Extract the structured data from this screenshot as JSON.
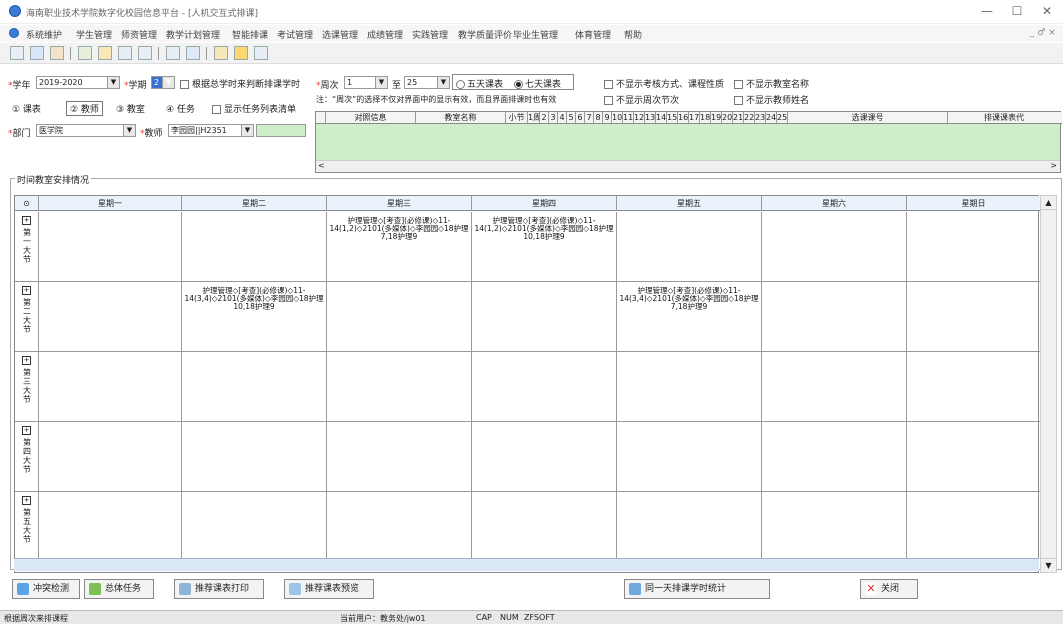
{
  "window": {
    "title": "海南职业技术学院数字化校园信息平台 - [人机交互式排课]",
    "min": "—",
    "max": "☐",
    "close": "✕"
  },
  "menu": [
    "系统维护",
    "学生管理",
    "师资管理",
    "教学计划管理",
    "智能排课",
    "考试管理",
    "选课管理",
    "成绩管理",
    "实践管理",
    "教学质量评价",
    "毕业生管理",
    "体育管理",
    "帮助"
  ],
  "menu_right": "_ ♂ ×",
  "filters": {
    "year_label": "学年",
    "year_value": "2019-2020",
    "term_label": "学期",
    "term_value": "2",
    "chk_hours": "根据总学时来判断排课学时",
    "week_label": "周次",
    "week_from": "1",
    "week_to_label": "至",
    "week_to": "25",
    "radio_five": "五天课表",
    "radio_seven": "七天课表",
    "note": "注：“周次”的选择不仅对界面中的显示有效，而且界面排课时也有效",
    "chk_no_exam": "不显示考核方式、课程性质",
    "chk_no_room": "不显示教室名称",
    "chk_no_week": "不显示周次节次",
    "chk_no_teacher": "不显示教师姓名",
    "opt_class": "① 课表",
    "opt_teacher": "② 教师",
    "opt_room": "③ 教室",
    "opt_task": "④ 任务",
    "chk_task_list": "显示任务列表清单",
    "dept_label": "部门",
    "dept_value": "医学院",
    "teacher_label": "教师",
    "teacher_value": "李园园||H2351"
  },
  "grid_headers": [
    "对照信息",
    "教室名称",
    "小节",
    "1周",
    "2",
    "3",
    "4",
    "5",
    "6",
    "7",
    "8",
    "9",
    "10",
    "11",
    "12",
    "13",
    "14",
    "15",
    "16",
    "17",
    "18",
    "19",
    "20",
    "21",
    "22",
    "23",
    "24",
    "25",
    "选课课号",
    "排课课表代"
  ],
  "group_title": "时间教室安排情况",
  "days": [
    "星期一",
    "星期二",
    "星期三",
    "星期四",
    "星期五",
    "星期六",
    "星期日"
  ],
  "corner": "⊙",
  "periods": [
    "第一大节",
    "第二大节",
    "第三大节",
    "第四大节",
    "第五大节"
  ],
  "courses": {
    "p1_wed": "护理管理◇[考查](必修课)◇11-14(1,2)◇2101(多媒体)◇李园园◇18护理7,18护理9",
    "p1_thu": "护理管理◇[考查](必修课)◇11-14(1,2)◇2101(多媒体)◇李园园◇18护理10,18护理9",
    "p2_tue": "护理管理◇[考查](必修课)◇11-14(3,4)◇2101(多媒体)◇李园园◇18护理10,18护理9",
    "p2_fri": "护理管理◇[考查](必修课)◇11-14(3,4)◇2101(多媒体)◇李园园◇18护理7,18护理9"
  },
  "buttons": {
    "conflict": "冲突检测",
    "total": "总体任务",
    "print": "推荐课表打印",
    "preview": "推荐课表预览",
    "sameday": "同一天排课学时统计",
    "close": "关闭"
  },
  "status": {
    "left": "根据周次来排课程",
    "user": "当前用户：教务处/jw01",
    "caps": "CAP",
    "num": "NUM",
    "zf": "ZFSOFT"
  },
  "colors": {
    "grid_body": "#cdeec8",
    "header": "#eaf3fc",
    "required": "#d33"
  }
}
